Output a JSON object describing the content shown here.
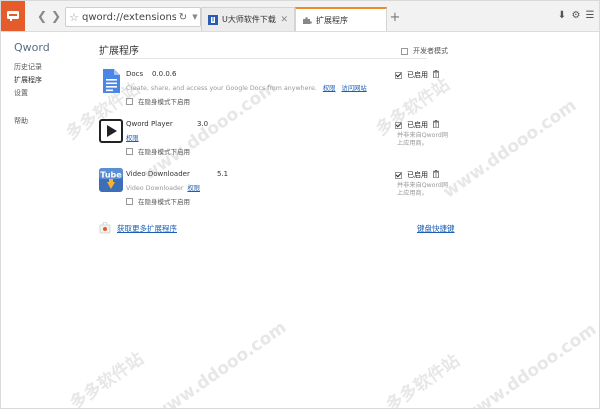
{
  "browser": {
    "address": "qword://extensions",
    "tabs": [
      {
        "label": "U大师软件下载中心 - 最伙"
      },
      {
        "label": "扩展程序"
      }
    ]
  },
  "sidebar": {
    "brand": "Qword",
    "items": [
      {
        "label": "历史记录"
      },
      {
        "label": "扩展程序"
      },
      {
        "label": "设置"
      },
      {
        "label": "帮助"
      }
    ]
  },
  "main": {
    "title": "扩展程序",
    "developer_mode": "开发者模式",
    "extensions": [
      {
        "name": "Docs",
        "version": "0.0.0.6",
        "description": "Create, share, and access your Google Docs from anywhere.",
        "links": [
          "权限",
          "访问网站"
        ],
        "incognito": "在隐身模式下启用",
        "enabled_label": "已启用",
        "note": ""
      },
      {
        "name": "Qword Player",
        "version": "3.0",
        "description": "",
        "links": [
          "权限"
        ],
        "incognito": "在隐身模式下启用",
        "enabled_label": "已启用",
        "note": [
          "并非来自Qword网",
          "上应用商。"
        ]
      },
      {
        "name": "Video Downloader",
        "version": "5.1",
        "description": "Video Downloader",
        "links": [
          "权限"
        ],
        "incognito": "在隐身模式下启用",
        "enabled_label": "已启用",
        "note": [
          "并非来自Qword网",
          "上应用商。"
        ]
      }
    ],
    "get_more": "获取更多扩展程序",
    "keyboard_shortcuts": "键盘快捷键"
  },
  "watermarks": [
    "多多软件站",
    "www.ddooo.com"
  ],
  "colors": {
    "accent": "#e55b2c",
    "link": "#1a5fb4",
    "tab_active_border": "#f08a24"
  }
}
